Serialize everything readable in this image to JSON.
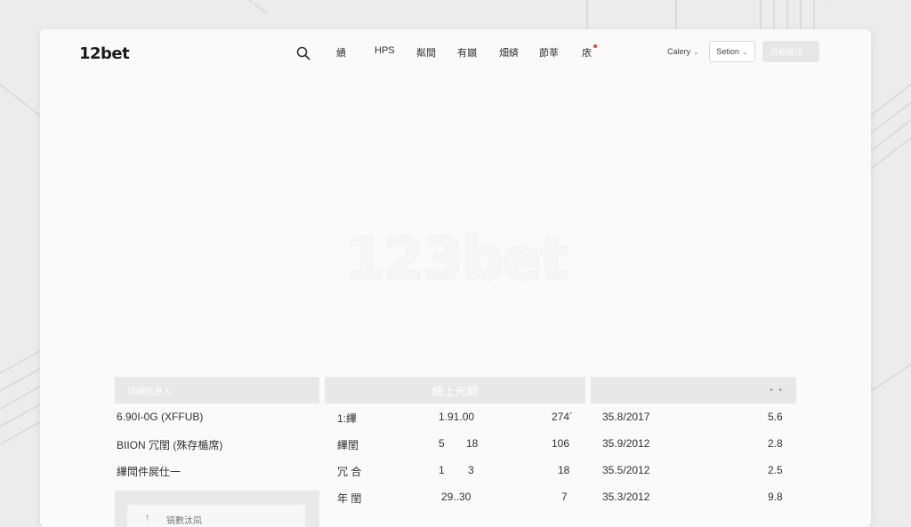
{
  "header": {
    "logo": "12bet",
    "nav": [
      "績",
      "HPS",
      "粼間",
      "有巓",
      "畑緕",
      "莭莘",
      "庡"
    ],
    "calery_label": "Calery",
    "setion_label": "Setion",
    "primary_label": "开始投注"
  },
  "hero": {
    "watermark": "123bet"
  },
  "panels": {
    "left": {
      "header": "详细信息入",
      "rows": [
        "6.90I-0G (XFFUB)",
        "BIION 冗閨 (殊存楯席)",
        "縪閗件屍仕一"
      ],
      "footer": "镐數汰凨"
    },
    "middle": {
      "header": "細上光綱",
      "rows": [
        {
          "label": "1:縪",
          "a": "1.91.00",
          "b": "274´"
        },
        {
          "label": "縪閨",
          "a": "5",
          "a2": "18",
          "b": "106"
        },
        {
          "label": "冗 合",
          "a": "1",
          "a2": "3",
          "b": "18"
        },
        {
          "label": "年 閨",
          "a": "29..30",
          "b": "7"
        }
      ]
    },
    "right": {
      "header": "• •",
      "rows": [
        {
          "date": "35.8/2017",
          "val": "5.6"
        },
        {
          "date": "35.9/2012",
          "val": "2.8"
        },
        {
          "date": "35.5/2012",
          "val": "2.5"
        },
        {
          "date": "35.3/2012",
          "val": "9.8"
        }
      ]
    }
  }
}
